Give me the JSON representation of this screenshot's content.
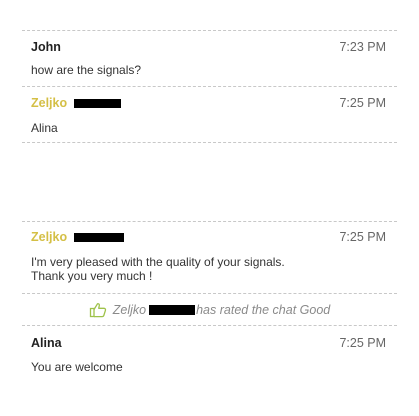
{
  "messages": [
    {
      "sender": "John",
      "time": "7:23 PM",
      "text": [
        "how are the signals?"
      ],
      "role": "visitor"
    },
    {
      "sender": "Zeljko",
      "time": "7:25 PM",
      "text": [
        "Alina"
      ],
      "role": "operator"
    },
    {
      "sender": "Zeljko",
      "time": "7:25 PM",
      "text": [
        "I'm very pleased with the quality of your signals.",
        "Thank you very much !"
      ],
      "role": "operator"
    },
    {
      "sender": "Alina",
      "time": "7:25 PM",
      "text": [
        "You are welcome"
      ],
      "role": "visitor"
    }
  ],
  "rating_event": {
    "icon": "thumbs-up-icon",
    "name": "Zeljko",
    "text": "has rated the chat Good"
  },
  "colors": {
    "operator_name": "#d4bf45",
    "rating_icon": "#9ec24a",
    "redaction": "#000000"
  }
}
